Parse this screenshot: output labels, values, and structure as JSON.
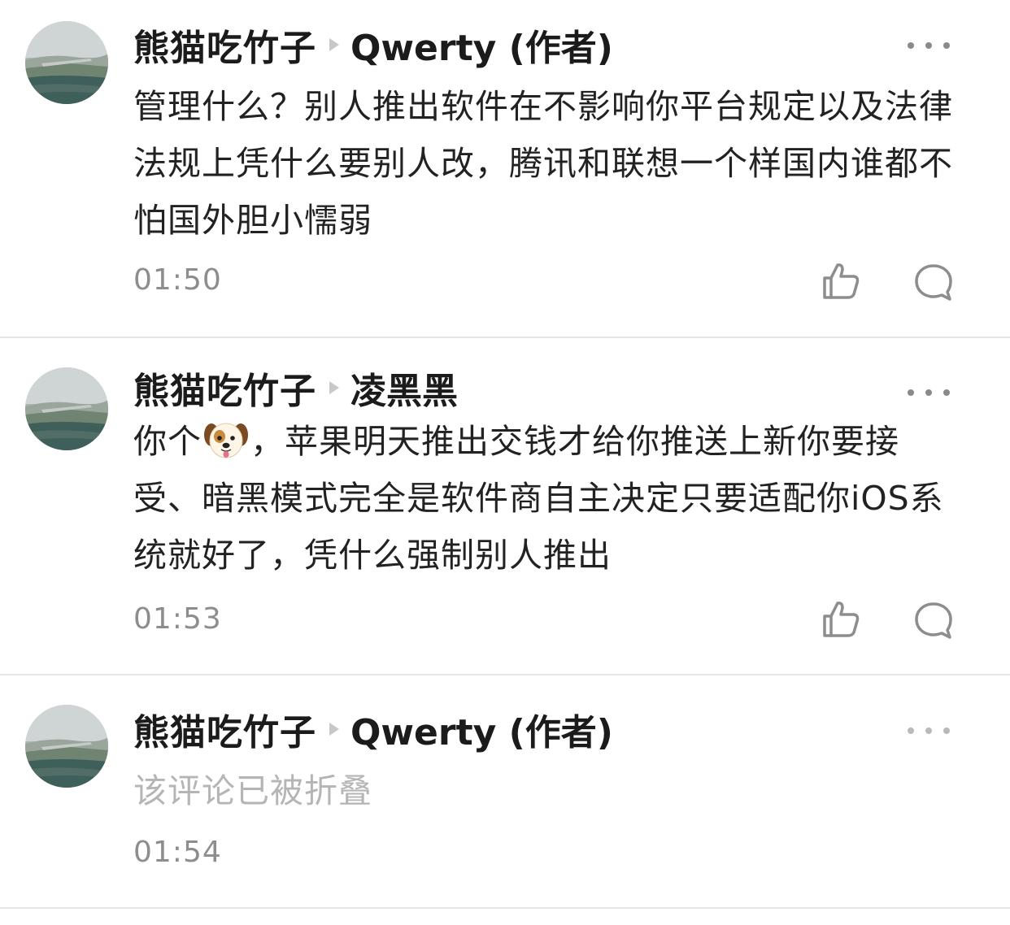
{
  "comments": [
    {
      "author": "熊猫吃竹子",
      "reply_to": "Qwerty (作者)",
      "text": "管理什么？别人推出软件在不影响你平台规定以及法律法规上凭什么要别人改，腾讯和联想一个样国内谁都不怕国外胆小懦弱",
      "time": "01:50",
      "more_icon": "more-dots-icon",
      "like_icon": "thumbs-up-icon",
      "reply_icon": "comment-bubble-icon"
    },
    {
      "author": "熊猫吃竹子",
      "reply_to": "凌黑黑",
      "text_before_emoji": "你个",
      "emoji": "dog-face-emoji",
      "text_after_emoji": "，苹果明天推出交钱才给你推送上新你要接受、暗黑模式完全是软件商自主决定只要适配你iOS系统就好了，凭什么强制别人推出",
      "time": "01:53",
      "more_icon": "more-dots-icon",
      "like_icon": "thumbs-up-icon",
      "reply_icon": "comment-bubble-icon"
    },
    {
      "author": "熊猫吃竹子",
      "reply_to": "Qwerty (作者)",
      "text": "该评论已被折叠",
      "time": "01:54",
      "more_icon": "more-dots-icon"
    }
  ],
  "colors": {
    "text": "#222222",
    "name": "#1b1b1b",
    "muted": "#8d8d8d",
    "folded": "#b5b5b5",
    "divider": "#e5e5e5"
  }
}
